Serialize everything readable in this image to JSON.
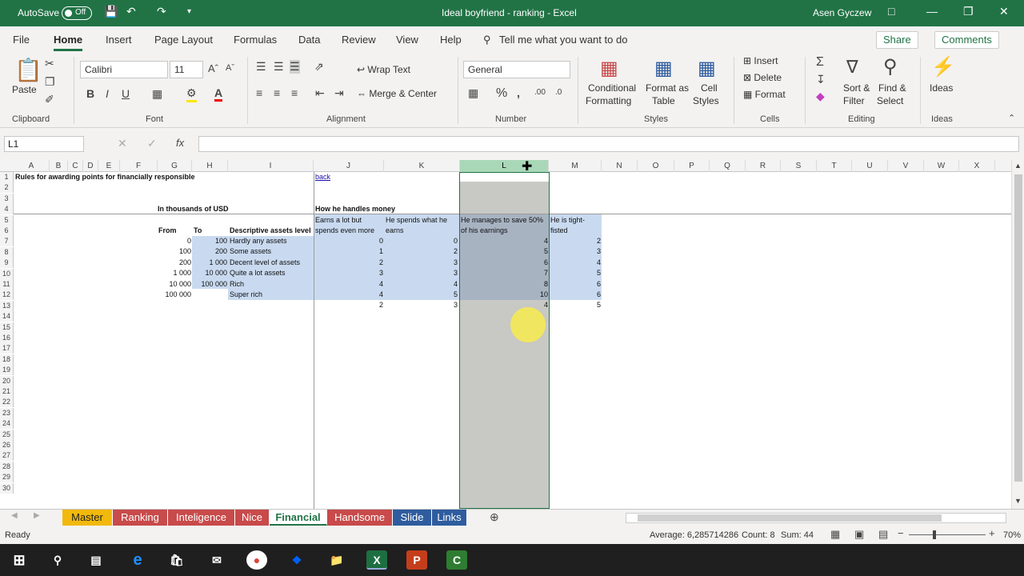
{
  "titlebar": {
    "autosave": "AutoSave",
    "toggle": "Off",
    "doc_title": "Ideal boyfriend - ranking  -  Excel",
    "user": "Asen Gyczew"
  },
  "ribbon_tabs": [
    "File",
    "Home",
    "Insert",
    "Page Layout",
    "Formulas",
    "Data",
    "Review",
    "View",
    "Help"
  ],
  "tell_me": "Tell me what you want to do",
  "share": "Share",
  "comments": "Comments",
  "ribbon": {
    "paste": "Paste",
    "font_name": "Calibri",
    "font_size": "11",
    "wrap_text": "Wrap Text",
    "merge_center": "Merge & Center",
    "number_format": "General",
    "conditional": "Conditional",
    "formatting": "Formatting",
    "format_as": "Format as",
    "table": "Table",
    "cell": "Cell",
    "styles_btn": "Styles",
    "insert": "Insert",
    "delete": "Delete",
    "format": "Format",
    "sort": "Sort &",
    "filter": "Filter",
    "find": "Find &",
    "select": "Select",
    "ideas": "Ideas",
    "groups": {
      "clipboard": "Clipboard",
      "font": "Font",
      "alignment": "Alignment",
      "number": "Number",
      "styles": "Styles",
      "cells": "Cells",
      "editing": "Editing",
      "ideas": "Ideas"
    }
  },
  "namebox": "L1",
  "fx": "fx",
  "columns": [
    "A",
    "B",
    "C",
    "D",
    "E",
    "F",
    "G",
    "H",
    "I",
    "J",
    "K",
    "L",
    "M",
    "N",
    "O",
    "P",
    "Q",
    "R",
    "S",
    "T",
    "U",
    "V",
    "W",
    "X"
  ],
  "rows": [
    "1",
    "2",
    "3",
    "4",
    "5",
    "6",
    "7",
    "8",
    "9",
    "10",
    "11",
    "12",
    "13",
    "14",
    "15",
    "16",
    "17",
    "18",
    "19",
    "20",
    "21",
    "22",
    "23",
    "24",
    "25",
    "26",
    "27",
    "28",
    "29",
    "30"
  ],
  "cells": {
    "title": "Rules for awarding points for financially responsible",
    "back": "back",
    "units": "In thousands of USD",
    "money_title": "How he handles money",
    "hdr_from": "From",
    "hdr_to": "To",
    "hdr_desc": "Descriptive assets level",
    "j5a": "Earns  a lot but",
    "j5b": "spends even more",
    "k5a": "He spends what he",
    "k5b": "earns",
    "l5a": "He manages to save 50%",
    "l5b": "of his earnings",
    "m5a": "He is tight-",
    "m5b": "fisted",
    "from": [
      "0",
      "100",
      "200",
      "1 000",
      "10 000",
      "100 000"
    ],
    "to": [
      "100",
      "200",
      "1 000",
      "10 000",
      "100 000",
      ""
    ],
    "desc": [
      "Hardly any assets",
      "Some assets",
      "Decent level of assets",
      "Quite a lot assets",
      "Rich",
      "Super rich"
    ],
    "j": [
      "0",
      "1",
      "2",
      "3",
      "4",
      "4",
      "2"
    ],
    "k": [
      "0",
      "2",
      "3",
      "3",
      "4",
      "5",
      "3"
    ],
    "l": [
      "4",
      "5",
      "6",
      "7",
      "8",
      "10",
      "4"
    ],
    "m": [
      "2",
      "3",
      "4",
      "5",
      "6",
      "6",
      "5"
    ]
  },
  "sheet_tabs": [
    {
      "name": "Master",
      "color": "#f2b90c",
      "text": "#222"
    },
    {
      "name": "Ranking",
      "color": "#c84a4a",
      "text": "#fff"
    },
    {
      "name": "Inteligence",
      "color": "#c84a4a",
      "text": "#fff"
    },
    {
      "name": "Nice",
      "color": "#c84a4a",
      "text": "#fff"
    },
    {
      "name": "Financial",
      "color": "#ffffff",
      "text": "#217346"
    },
    {
      "name": "Handsome",
      "color": "#c84a4a",
      "text": "#fff"
    },
    {
      "name": "Slide",
      "color": "#2e5c9e",
      "text": "#fff"
    },
    {
      "name": "Links",
      "color": "#2e5c9e",
      "text": "#fff"
    }
  ],
  "status": {
    "ready": "Ready",
    "average": "Average: 6,285714286",
    "count": "Count: 8",
    "sum": "Sum: 44",
    "zoom": "70%"
  }
}
